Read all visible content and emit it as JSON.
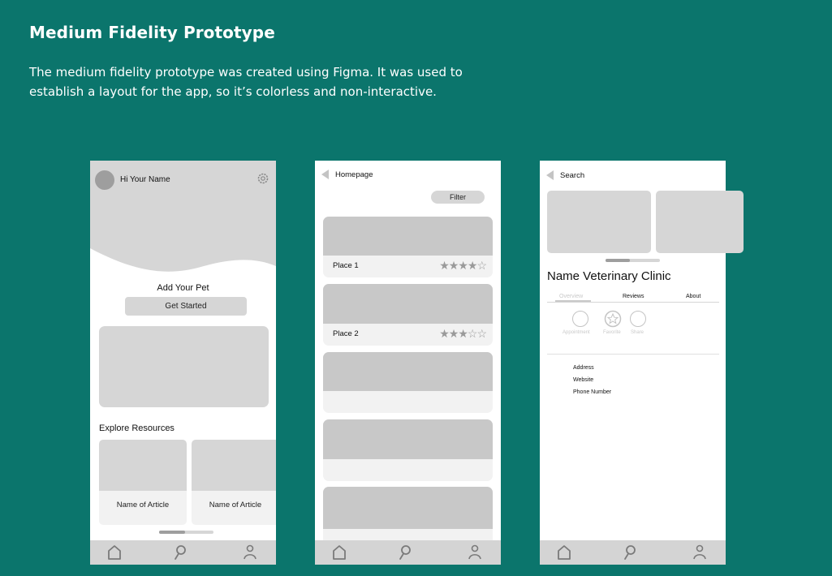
{
  "header": {
    "title": "Medium Fidelity Prototype",
    "description": "The medium fidelity prototype was created using Figma. It was used to establish a layout for the app, so it’s colorless and non-interactive."
  },
  "home_screen": {
    "greeting": "Hi Your Name",
    "add_pet_title": "Add Your Pet",
    "get_started_label": "Get Started",
    "explore_title": "Explore Resources",
    "articles": [
      "Name of Article",
      "Name of Article"
    ]
  },
  "list_screen": {
    "back_label": "Homepage",
    "filter_label": "Filter",
    "places": [
      {
        "name": "Place 1",
        "stars": "★★★★☆"
      },
      {
        "name": "Place 2",
        "stars": "★★★☆☆"
      }
    ]
  },
  "detail_screen": {
    "back_label": "Search",
    "clinic_name": "Name Veterinary Clinic",
    "tabs": [
      "Overview",
      "Reviews",
      "About"
    ],
    "actions": [
      "Appointment",
      "Favorite",
      "Share"
    ],
    "info": [
      "Address",
      "Website",
      "Phone Number"
    ]
  },
  "icons": [
    "settings-icon",
    "back-arrow-icon",
    "home-icon",
    "search-icon",
    "profile-icon",
    "star-icon"
  ]
}
